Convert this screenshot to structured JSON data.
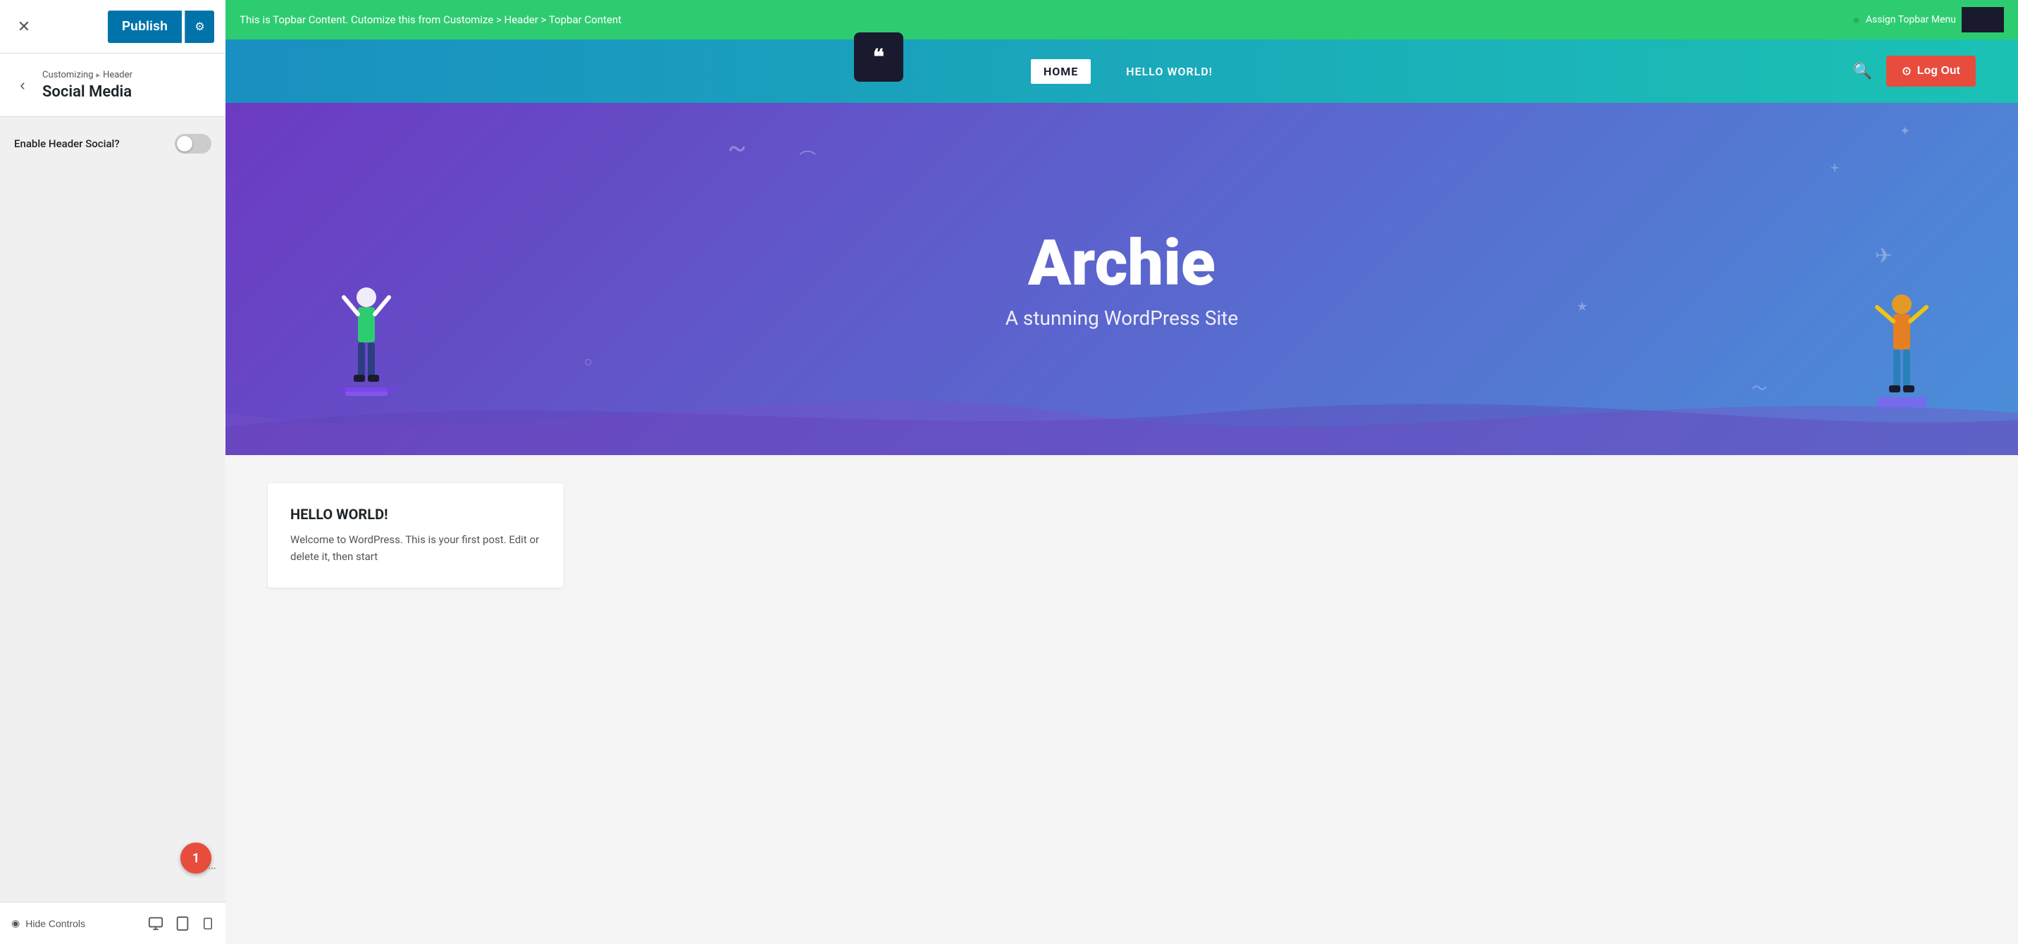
{
  "customizer": {
    "close_label": "✕",
    "publish_label": "Publish",
    "publish_settings_icon": "⚙",
    "back_icon": "‹",
    "breadcrumb_part1": "Customizing",
    "breadcrumb_arrow": "▸",
    "breadcrumb_part2": "Header",
    "section_title": "Social Media",
    "enable_header_social_label": "Enable Header Social?",
    "toggle_state": false,
    "notification_count": "1",
    "hide_controls_label": "Hide Controls",
    "eye_icon": "👁",
    "desktop_icon": "🖥",
    "tablet_icon": "📱",
    "mobile_icon": "📱"
  },
  "preview": {
    "topbar_text": "This is Topbar Content. Cutomize this from Customize > Header > Topbar Content",
    "assign_menu_label": "Assign Topbar Menu",
    "topbar_dot": "●",
    "nav_items": [
      {
        "label": "HOME",
        "active": true
      },
      {
        "label": "HELLO WORLD!",
        "active": false
      }
    ],
    "logout_label": "Log Out",
    "hero_title": "Archie",
    "hero_subtitle": "A stunning WordPress Site",
    "content_card_title": "HELLO WORLD!",
    "content_card_text": "Welcome to WordPress. This is your first post. Edit or delete it, then start",
    "logo_symbol": "❝",
    "search_icon": "🔍",
    "logout_icon": "⊙"
  },
  "colors": {
    "publish_btn": "#0073aa",
    "topbar_bg": "#2ecc71",
    "nav_gradient_start": "#1a8fc1",
    "nav_gradient_end": "#1bc2b4",
    "hero_gradient_start": "#6c3ac2",
    "hero_gradient_end": "#4a90d9",
    "logout_red": "#e74c3c",
    "badge_red": "#e74c3c"
  }
}
